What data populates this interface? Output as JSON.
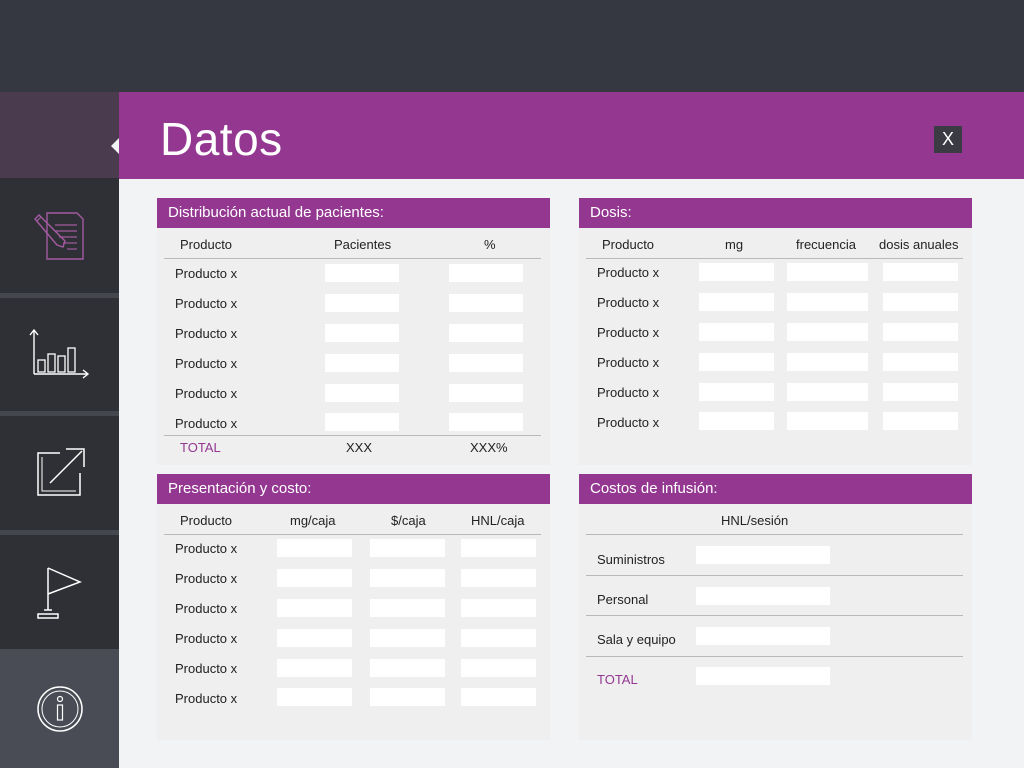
{
  "title": "Datos",
  "close_label": "X",
  "sidebar": {
    "items": [
      {
        "icon": "document-pencil-icon"
      },
      {
        "icon": "bar-chart-icon"
      },
      {
        "icon": "external-link-icon"
      },
      {
        "icon": "flag-icon"
      },
      {
        "icon": "info-icon"
      }
    ]
  },
  "dist": {
    "header": "Distribución actual de pacientes:",
    "cols": [
      "Producto",
      "Pacientes",
      "%"
    ],
    "rows": [
      "Producto x",
      "Producto x",
      "Producto x",
      "Producto x",
      "Producto x",
      "Producto x"
    ],
    "total_label": "TOTAL",
    "total_patients": "XXX",
    "total_pct": "XXX%"
  },
  "dosis": {
    "header": "Dosis:",
    "cols": [
      "Producto",
      "mg",
      "frecuencia",
      "dosis anuales"
    ],
    "rows": [
      "Producto x",
      "Producto x",
      "Producto x",
      "Producto x",
      "Producto x",
      "Producto x"
    ]
  },
  "pres": {
    "header": "Presentación y costo:",
    "cols": [
      "Producto",
      "mg/caja",
      "$/caja",
      "HNL/caja"
    ],
    "rows": [
      "Producto x",
      "Producto x",
      "Producto x",
      "Producto x",
      "Producto x",
      "Producto x"
    ]
  },
  "infusion": {
    "header": "Costos de infusión:",
    "col": "HNL/sesión",
    "rows": [
      "Suministros",
      "Personal",
      "Sala y equipo"
    ],
    "total_label": "TOTAL"
  },
  "colors": {
    "accent": "#943791",
    "dark": "#2f3036"
  }
}
